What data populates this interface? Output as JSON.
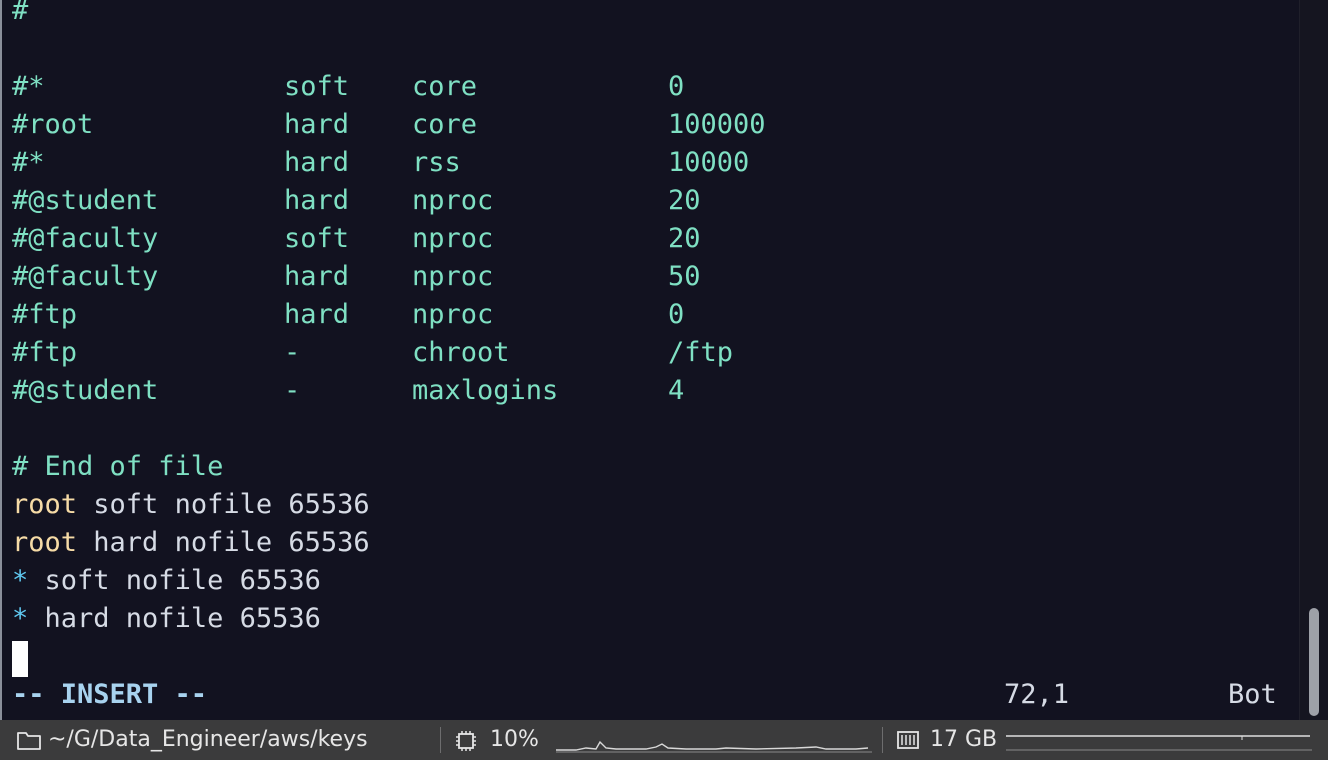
{
  "editor": {
    "top_comment": "#",
    "limits_table": [
      {
        "domain": "#*",
        "type": "soft",
        "item": "core",
        "value": "0"
      },
      {
        "domain": "#root",
        "type": "hard",
        "item": "core",
        "value": "100000"
      },
      {
        "domain": "#*",
        "type": "hard",
        "item": "rss",
        "value": "10000"
      },
      {
        "domain": "#@student",
        "type": "hard",
        "item": "nproc",
        "value": "20"
      },
      {
        "domain": "#@faculty",
        "type": "soft",
        "item": "nproc",
        "value": "20"
      },
      {
        "domain": "#@faculty",
        "type": "hard",
        "item": "nproc",
        "value": "50"
      },
      {
        "domain": "#ftp",
        "type": "hard",
        "item": "nproc",
        "value": "0"
      },
      {
        "domain": "#ftp",
        "type": "-",
        "item": "chroot",
        "value": "/ftp"
      },
      {
        "domain": "#@student",
        "type": "-",
        "item": "maxlogins",
        "value": "4"
      }
    ],
    "end_comment": "# End of file",
    "added_lines": [
      {
        "domain": "root",
        "rest": " soft nofile 65536"
      },
      {
        "domain": "root",
        "rest": " hard nofile 65536"
      },
      {
        "domain": "*",
        "rest": " soft nofile 65536"
      },
      {
        "domain": "*",
        "rest": " hard nofile 65536"
      }
    ]
  },
  "vim_status": {
    "mode": "-- INSERT --",
    "position": "72,1",
    "scroll": "Bot"
  },
  "statusbar": {
    "path": "~/G/Data_Engineer/aws/keys",
    "cpu": "10%",
    "memory": "17 GB",
    "icons": [
      "folder-icon",
      "cpu-chip-icon",
      "memory-icon"
    ]
  },
  "colors": {
    "background": "#121220",
    "comment": "#7fe0c3",
    "root_keyword": "#f6dba6",
    "star_keyword": "#5fc8f0",
    "text": "#d6dbe5",
    "statusbar": "#3b3b3c"
  }
}
